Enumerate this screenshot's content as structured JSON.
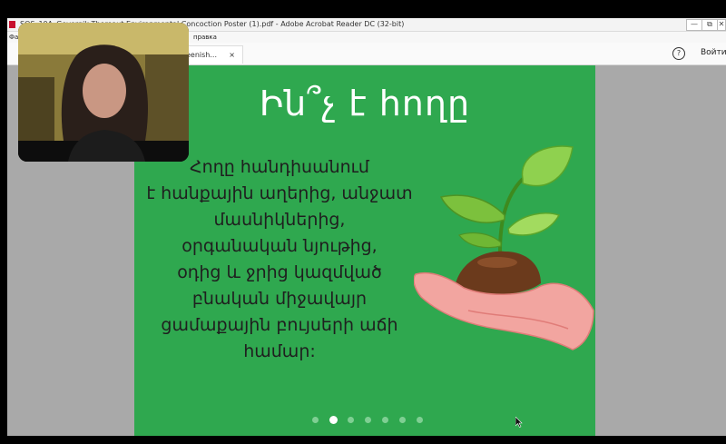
{
  "window": {
    "title": "SOS_10A_Gevorgik Thoreaut Environmental Concoction Poster (1).pdf - Adobe Acrobat Reader DC (32-bit)",
    "minimize": "—",
    "maximize": "⧉",
    "close": "✕"
  },
  "menu": {
    "item1": "Фа",
    "item2": "правка"
  },
  "toolbar": {
    "tab_label": "eenish...",
    "tab_close": "×",
    "help": "?",
    "signin": "Войти"
  },
  "slide": {
    "title": "Ին՞չ է հողը",
    "body_lines": [
      "Հողը հանդիսանում",
      "է հանքային աղերից, անջատ",
      "մասնիկներից,",
      "օրգանական նյութից,",
      "օդից և ջրից կազմված",
      "բնական միջավայր",
      "ցամաքային բույսերի աճի",
      "համար:"
    ],
    "pagination_count": 7,
    "pagination_active": 2
  },
  "colors": {
    "slide_bg": "#2fa84f",
    "background_gray": "#a9a9a9",
    "acrobat_red": "#c8102e"
  }
}
